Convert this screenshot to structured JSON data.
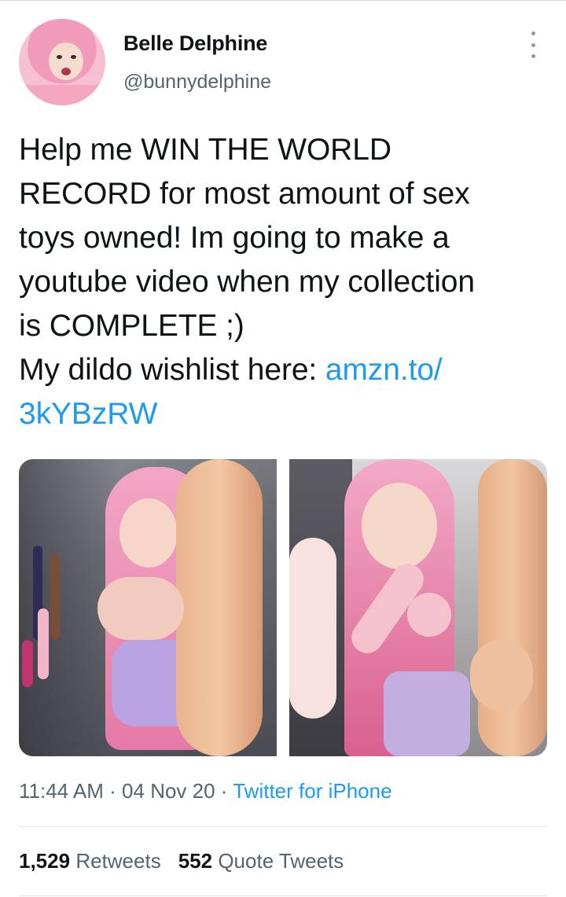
{
  "author": {
    "name": "Belle Delphine",
    "handle": "@bunnydelphine"
  },
  "tweet": {
    "text": "Help me WIN THE WORLD\nRECORD for most amount of sex\ntoys owned! Im going to make a\nyoutube video when my collection\nis COMPLETE ;)\nMy dildo wishlist here: ",
    "link_text": "amzn.to/\n3kYBzRW"
  },
  "meta": {
    "time": "11:44 AM",
    "separator1": " · ",
    "date": "04 Nov 20",
    "separator2": " · ",
    "source": "Twitter for iPhone"
  },
  "stats": {
    "retweets_count": "1,529",
    "retweets_label": "Retweets",
    "quotes_count": "552",
    "quotes_label": "Quote Tweets"
  },
  "icons": {
    "more": "more-vertical-icon"
  },
  "colors": {
    "link": "#1d9bf0",
    "secondary_text": "#536471",
    "primary_text": "#0f1419"
  }
}
